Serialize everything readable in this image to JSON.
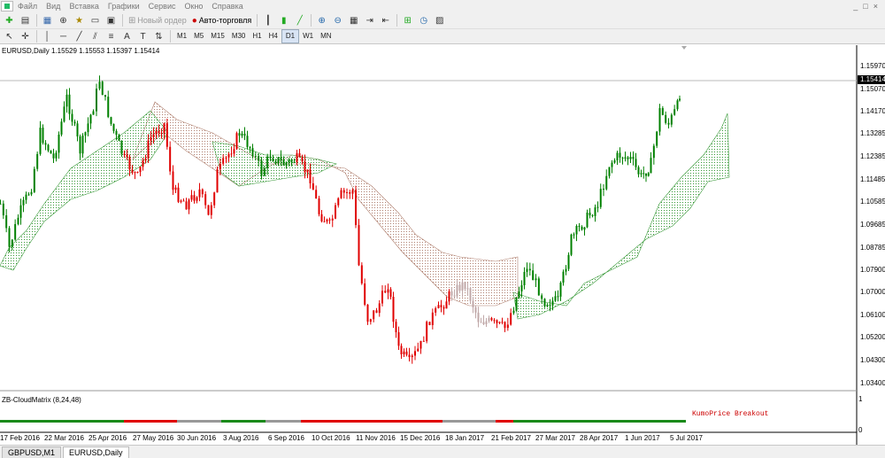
{
  "menu": [
    "Файл",
    "Вид",
    "Вставка",
    "Графики",
    "Сервис",
    "Окно",
    "Справка"
  ],
  "window_controls": [
    "_",
    "□",
    "×"
  ],
  "toolbar": {
    "new_order": "Новый ордер",
    "auto_trading": "Авто-торговля"
  },
  "timeframes": [
    "M1",
    "M5",
    "M15",
    "M30",
    "H1",
    "H4",
    "D1",
    "W1",
    "MN"
  ],
  "active_timeframe": "D1",
  "chart_info": "EURUSD,Daily  1.15529 1.15553 1.15397 1.15414",
  "current_price": "1.15414",
  "price_labels": [
    "1.15970",
    "1.15070",
    "1.14170",
    "1.13285",
    "1.12385",
    "1.11485",
    "1.10585",
    "1.09685",
    "1.08785",
    "1.07900",
    "1.07000",
    "1.06100",
    "1.05200",
    "1.04300",
    "1.03400"
  ],
  "indicator": {
    "name": "ZB-CloudMatrix (8,24,48)",
    "scale_top": "1",
    "scale_bottom": "0",
    "kumo_label": "KumoPrice Breakout"
  },
  "dates": [
    "17 Feb 2016",
    "22 Mar 2016",
    "25 Apr 2016",
    "27 May 2016",
    "30 Jun 2016",
    "3 Aug 2016",
    "6 Sep 2016",
    "10 Oct 2016",
    "11 Nov 2016",
    "15 Dec 2016",
    "18 Jan 2017",
    "21 Feb 2017",
    "27 Mar 2017",
    "28 Apr 2017",
    "1 Jun 2017",
    "5 Jul 2017"
  ],
  "tabs": [
    "GBPUSD,M1",
    "EURUSD,Daily"
  ],
  "active_tab": "EURUSD,Daily",
  "colors": {
    "up": "#008000",
    "down": "#e00000",
    "neutral": "#c0a8a8",
    "cloud_up": "#3a9a3a",
    "cloud_down": "#b08070"
  },
  "chart_data": {
    "type": "candlestick",
    "symbol": "EURUSD",
    "timeframe": "Daily",
    "x": [
      "17 Feb 2016",
      "22 Mar 2016",
      "25 Apr 2016",
      "27 May 2016",
      "30 Jun 2016",
      "3 Aug 2016",
      "6 Sep 2016",
      "10 Oct 2016",
      "11 Nov 2016",
      "15 Dec 2016",
      "18 Jan 2017",
      "21 Feb 2017",
      "27 Mar 2017",
      "28 Apr 2017",
      "1 Jun 2017",
      "5 Jul 2017"
    ],
    "close": [
      1.115,
      1.128,
      1.14,
      1.112,
      1.111,
      1.12,
      1.124,
      1.098,
      1.078,
      1.042,
      1.068,
      1.055,
      1.081,
      1.094,
      1.126,
      1.154
    ],
    "ylim": [
      1.032,
      1.162
    ]
  }
}
